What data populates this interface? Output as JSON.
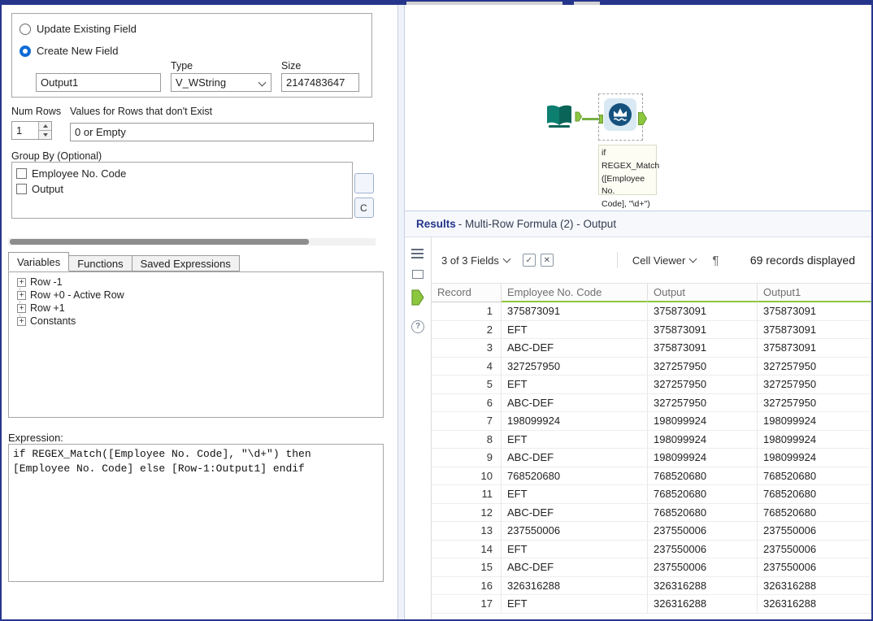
{
  "config": {
    "radios": [
      {
        "label": "Update Existing Field",
        "selected": false
      },
      {
        "label": "Create New Field",
        "selected": true
      }
    ],
    "field_name_value": "Output1",
    "type_label": "Type",
    "type_value": "V_WString",
    "size_label": "Size",
    "size_value": "2147483647",
    "num_rows_label": "Num Rows",
    "num_rows_value": "1",
    "values_label": "Values for Rows that don't Exist",
    "values_value": "0 or Empty",
    "group_by_label": "Group By (Optional)",
    "group_by_items": [
      {
        "label": "Employee No. Code",
        "checked": false
      },
      {
        "label": "Output",
        "checked": false
      }
    ],
    "button_fragment": "C",
    "tabs": [
      {
        "label": "Variables",
        "active": true
      },
      {
        "label": "Functions",
        "active": false
      },
      {
        "label": "Saved Expressions",
        "active": false
      }
    ],
    "tree_items": [
      {
        "label": "Row -1"
      },
      {
        "label": "Row +0 - Active Row"
      },
      {
        "label": "Row +1"
      },
      {
        "label": "Constants"
      }
    ],
    "expression_label": "Expression:",
    "expression_text": "if REGEX_Match([Employee No. Code], \"\\d+\") then\n[Employee No. Code] else [Row-1:Output1] endif"
  },
  "canvas": {
    "annotation_lines": [
      "if REGEX_Match",
      "([Employee No.",
      "Code], \"\\d+\")"
    ]
  },
  "results": {
    "title_bold": "Results",
    "title_rest": "- Multi-Row Formula (2) - Output",
    "toolbar": {
      "fields_label": "3 of 3 Fields",
      "check_icon_glyph": "✓",
      "x_icon_glyph": "✕",
      "cell_viewer_label": "Cell Viewer",
      "pilcrow_glyph": "¶",
      "records_label": "69 records displayed"
    },
    "table": {
      "columns": [
        "Record",
        "Employee No. Code",
        "Output",
        "Output1"
      ],
      "rows": [
        [
          "1",
          "375873091",
          "375873091",
          "375873091"
        ],
        [
          "2",
          "EFT",
          "375873091",
          "375873091"
        ],
        [
          "3",
          "ABC-DEF",
          "375873091",
          "375873091"
        ],
        [
          "4",
          "327257950",
          "327257950",
          "327257950"
        ],
        [
          "5",
          "EFT",
          "327257950",
          "327257950"
        ],
        [
          "6",
          "ABC-DEF",
          "327257950",
          "327257950"
        ],
        [
          "7",
          "198099924",
          "198099924",
          "198099924"
        ],
        [
          "8",
          "EFT",
          "198099924",
          "198099924"
        ],
        [
          "9",
          "ABC-DEF",
          "198099924",
          "198099924"
        ],
        [
          "10",
          "768520680",
          "768520680",
          "768520680"
        ],
        [
          "11",
          "EFT",
          "768520680",
          "768520680"
        ],
        [
          "12",
          "ABC-DEF",
          "768520680",
          "768520680"
        ],
        [
          "13",
          "237550006",
          "237550006",
          "237550006"
        ],
        [
          "14",
          "EFT",
          "237550006",
          "237550006"
        ],
        [
          "15",
          "ABC-DEF",
          "237550006",
          "237550006"
        ],
        [
          "16",
          "326316288",
          "326316288",
          "326316288"
        ],
        [
          "17",
          "EFT",
          "326316288",
          "326316288"
        ]
      ]
    }
  },
  "colors": {
    "accent_navy": "#26358c",
    "anchor_green": "#8dc63f",
    "tool_blue": "#16517e",
    "header_underline_green": "#8dc63f"
  }
}
